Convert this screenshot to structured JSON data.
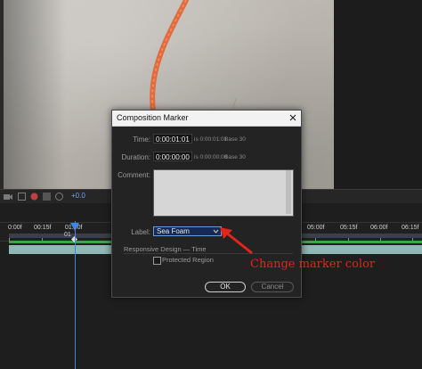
{
  "viewer": {
    "zoom_readout": "+0.0"
  },
  "timeline": {
    "ticks": [
      "0:00f",
      "00:15f",
      "01:00f",
      "05:00f",
      "05:15f",
      "06:00f",
      "06:15f"
    ],
    "marker_text": "01"
  },
  "dialog": {
    "title": "Composition Marker",
    "time": {
      "label": "Time:",
      "value": "0:00:01:01",
      "note_is": "is 0:00:01:01",
      "note_base": "Base 30"
    },
    "duration": {
      "label": "Duration:",
      "value": "0:00:00:00",
      "note_is": "is 0:00:00:00",
      "note_base": "Base 30"
    },
    "comment": {
      "label": "Comment:",
      "value": ""
    },
    "label_field": {
      "label": "Label:",
      "selected": "Sea Foam"
    },
    "responsive": {
      "title": "Responsive Design — Time",
      "protected_label": "Protected Region",
      "protected_checked": false
    },
    "ok_label": "OK",
    "cancel_label": "Cancel"
  },
  "annotation": {
    "text": "Change marker color",
    "color": "#e3241b"
  },
  "colors": {
    "accent": "#3d86e6",
    "layer_bar": "#8fb7b4",
    "green_bar": "#3fa34a"
  }
}
